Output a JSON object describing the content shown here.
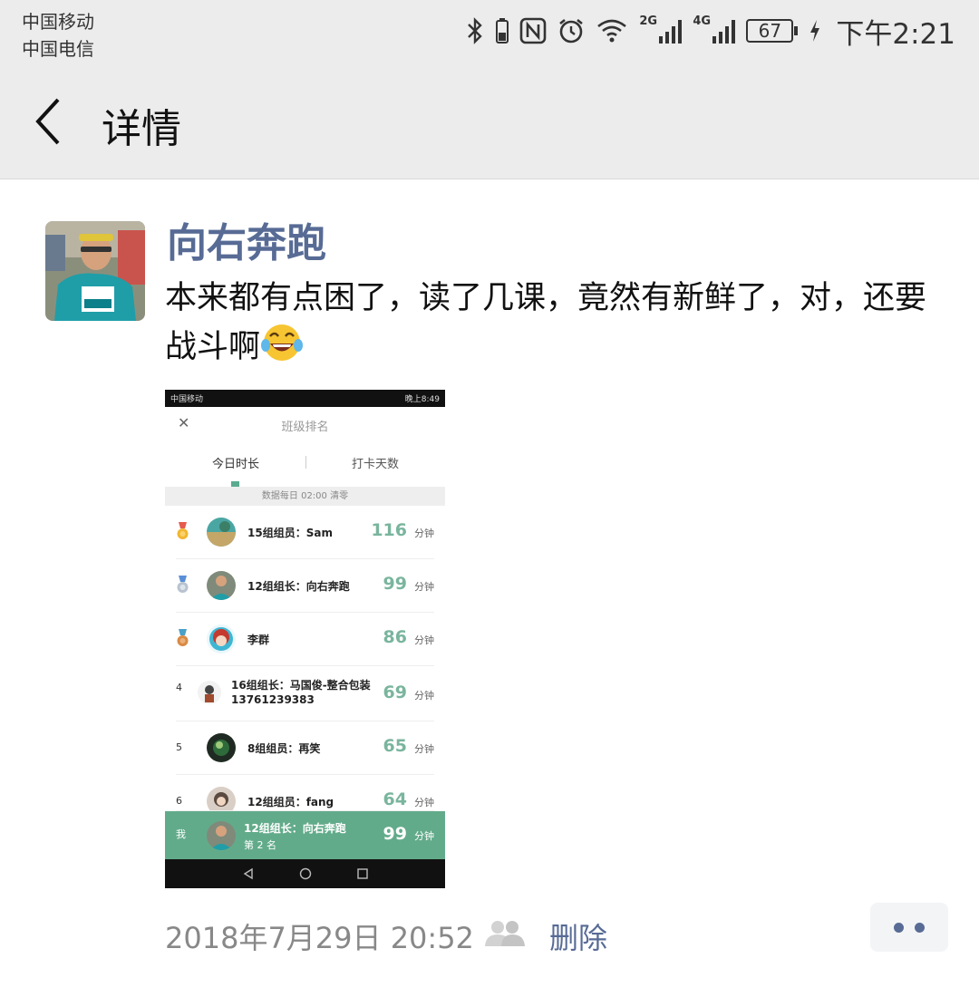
{
  "status_bar": {
    "carrier_1": "中国移动",
    "carrier_2": "中国电信",
    "net_2g": "2G",
    "net_4g": "4G",
    "battery": "67",
    "time": "下午2:21"
  },
  "nav": {
    "title": "详情"
  },
  "post": {
    "username": "向右奔跑",
    "text": "本来都有点困了，读了几课，竟然有新鲜了，对，还要战斗啊",
    "timestamp": "2018年7月29日 20:52",
    "delete_label": "删除"
  },
  "screenshot": {
    "carrier": "中国移动",
    "time": "晚上8:49",
    "title": "班级排名",
    "tabs": [
      "今日时长",
      "打卡天数"
    ],
    "note": "数据每日 02:00 清零",
    "unit": "分钟",
    "rows": [
      {
        "rank": "1",
        "name": "15组组员：Sam",
        "value": "116"
      },
      {
        "rank": "2",
        "name": "12组组长：向右奔跑",
        "value": "99"
      },
      {
        "rank": "3",
        "name": "李群",
        "value": "86"
      },
      {
        "rank": "4",
        "name": "16组组长：马国俊-整合包装",
        "sub": "13761239383",
        "value": "69"
      },
      {
        "rank": "5",
        "name": "8组组员：再笑",
        "value": "65"
      },
      {
        "rank": "6",
        "name": "12组组员：fang",
        "value": "64"
      }
    ],
    "me": {
      "label": "我",
      "name": "12组组长：向右奔跑",
      "rank_text": "第 2 名",
      "value": "99",
      "unit": "分钟"
    }
  },
  "colors": {
    "link": "#576b95",
    "accent_green": "#62ab8a",
    "value_green": "#7ab59e"
  }
}
